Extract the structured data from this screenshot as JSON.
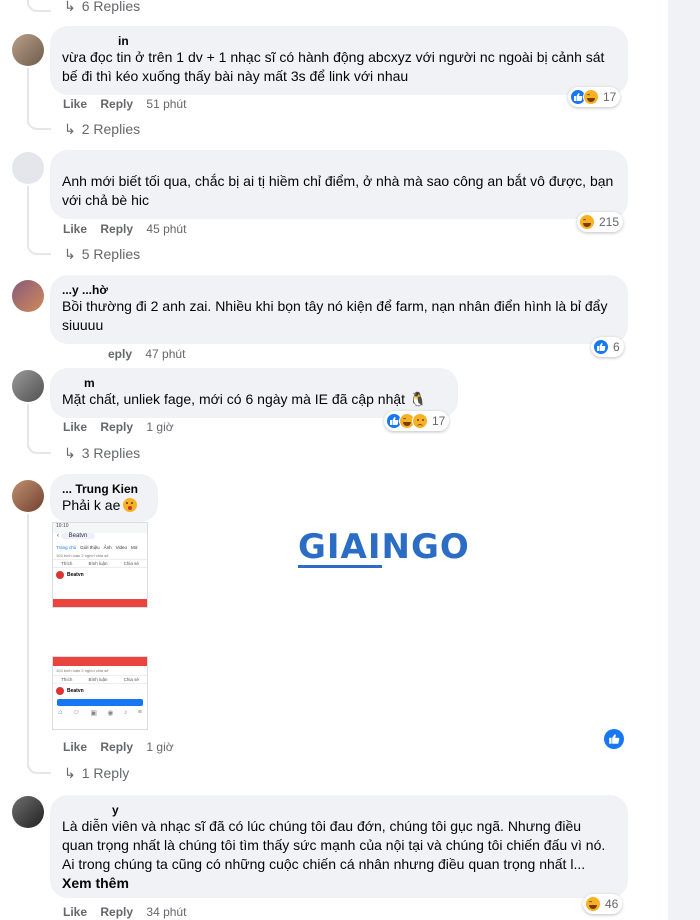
{
  "top_replies": "6 Replies",
  "comments": [
    {
      "author": "in",
      "text": "vừa đọc tin ở trên 1 dv + 1 nhạc sĩ có hành động abcxyz với người nc ngoài bị cảnh sát bế đi thì kéo xuống thấy bài này mất 3s để link với nhau",
      "like": "Like",
      "reply": "Reply",
      "time": "51 phút",
      "reaction_count": "17",
      "replies": "2 Replies"
    },
    {
      "author": "",
      "text": "Anh mới biết tối qua, chắc bị ai tị hiềm chỉ điểm, ở nhà mà sao công an bắt vô được, bạn với chả bè hic",
      "like": "Like",
      "reply": "Reply",
      "time": "45 phút",
      "reaction_count": "215",
      "replies": "5 Replies"
    },
    {
      "author": "...y ...hờ",
      "text": "Bồi thường đi 2 anh zai. Nhiều khi bọn tây nó kiện để farm, nạn nhân điển hình là bỉ đẩy siuuuu",
      "like": "",
      "reply": "eply",
      "time": "47 phút",
      "reaction_count": "6",
      "replies": ""
    },
    {
      "author": "m",
      "text": "Mặt chất, unliek fage, mới có 6 ngày mà IE đã cập nhật",
      "like": "Like",
      "reply": "Reply",
      "time": "1 giờ",
      "reaction_count": "17",
      "replies": "3 Replies"
    },
    {
      "author": "... Trung Kien",
      "text": "Phải k ae",
      "like": "Like",
      "reply": "Reply",
      "time": "1 giờ",
      "reaction_count": "",
      "replies": "1 Reply"
    },
    {
      "author": "y",
      "text": "Là diễn viên và nhạc sĩ đã có lúc chúng tôi đau đớn, chúng tôi gục ngã. Nhưng điều quan trọng nhất là chúng tôi tìm thấy sức mạnh của nội tại và chúng tôi chiến đấu vì nó. Ai trong chúng ta cũng có những cuộc chiến cá nhân nhưng điều quan trọng nhất l...",
      "see_more": "Xem thêm",
      "like": "Like",
      "reply": "Reply",
      "time": "34 phút",
      "reaction_count": "46"
    }
  ],
  "screenshot_thumb": {
    "page_name": "Beatvn",
    "tabs": [
      "Trang chủ",
      "Giới thiệu",
      "Ảnh",
      "Video",
      "Mở"
    ],
    "actions": [
      "Thích",
      "Bình luận",
      "Chia sẻ"
    ],
    "stats": "104 bình luận  2 nghìn chia sẻ"
  },
  "watermark": "GIAINGO",
  "colors": {
    "like_blue": "#1877f2",
    "bubble_bg": "#f0f2f5",
    "meta_gray": "#65676b",
    "watermark": "#2b6cc4"
  }
}
